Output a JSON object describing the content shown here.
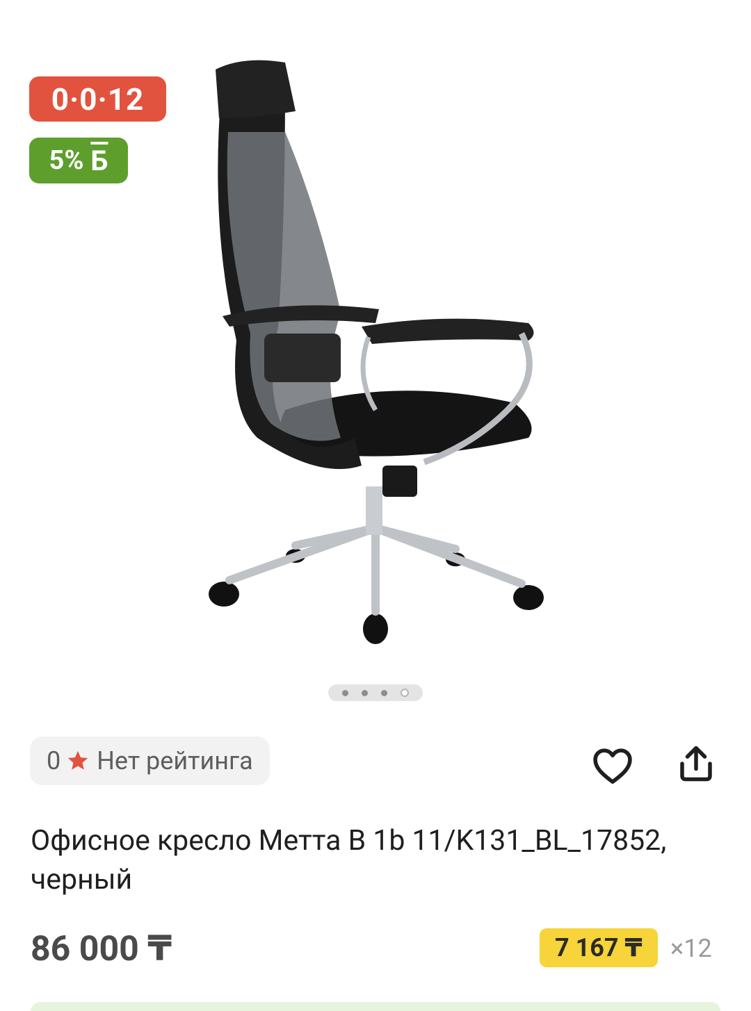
{
  "badges": {
    "installment": "0·0·12",
    "bonus_percent": "5%",
    "bonus_symbol": "Б"
  },
  "gallery": {
    "image_icon": "office-chair-image",
    "total_slides": 4,
    "active_slide": 4
  },
  "rating": {
    "count": "0",
    "label": "Нет рейтинга",
    "star_color": "#e2533f"
  },
  "actions": {
    "favorite_icon": "heart-icon",
    "share_icon": "share-icon"
  },
  "product": {
    "title": "Офисное кресло Метта B 1b 11/K131_BL_17852, черный",
    "price": "86 000 ₸",
    "monthly_payment": "7 167 ₸",
    "months": "×12"
  },
  "colors": {
    "installment_badge": "#e2533f",
    "bonus_badge": "#5e9e2d",
    "monthly_badge": "#f6d43a"
  }
}
